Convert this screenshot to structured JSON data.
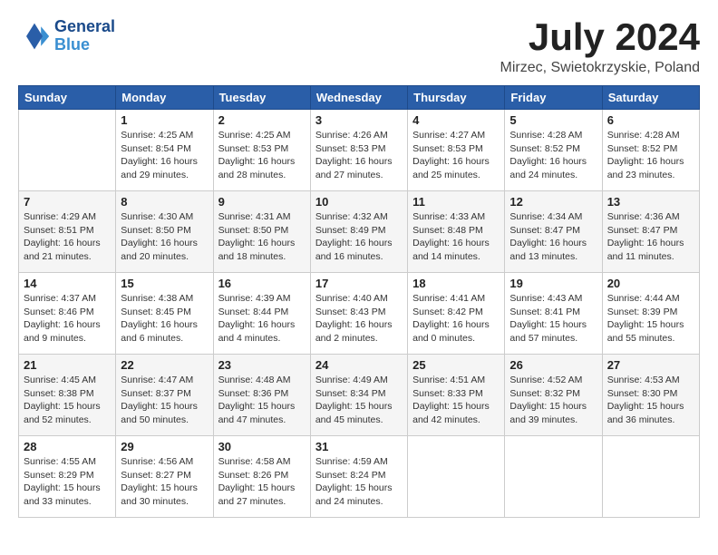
{
  "header": {
    "logo_line1": "General",
    "logo_line2": "Blue",
    "month_title": "July 2024",
    "location": "Mirzec, Swietokrzyskie, Poland"
  },
  "weekdays": [
    "Sunday",
    "Monday",
    "Tuesday",
    "Wednesday",
    "Thursday",
    "Friday",
    "Saturday"
  ],
  "weeks": [
    [
      {
        "day": "",
        "info": ""
      },
      {
        "day": "1",
        "info": "Sunrise: 4:25 AM\nSunset: 8:54 PM\nDaylight: 16 hours\nand 29 minutes."
      },
      {
        "day": "2",
        "info": "Sunrise: 4:25 AM\nSunset: 8:53 PM\nDaylight: 16 hours\nand 28 minutes."
      },
      {
        "day": "3",
        "info": "Sunrise: 4:26 AM\nSunset: 8:53 PM\nDaylight: 16 hours\nand 27 minutes."
      },
      {
        "day": "4",
        "info": "Sunrise: 4:27 AM\nSunset: 8:53 PM\nDaylight: 16 hours\nand 25 minutes."
      },
      {
        "day": "5",
        "info": "Sunrise: 4:28 AM\nSunset: 8:52 PM\nDaylight: 16 hours\nand 24 minutes."
      },
      {
        "day": "6",
        "info": "Sunrise: 4:28 AM\nSunset: 8:52 PM\nDaylight: 16 hours\nand 23 minutes."
      }
    ],
    [
      {
        "day": "7",
        "info": "Sunrise: 4:29 AM\nSunset: 8:51 PM\nDaylight: 16 hours\nand 21 minutes."
      },
      {
        "day": "8",
        "info": "Sunrise: 4:30 AM\nSunset: 8:50 PM\nDaylight: 16 hours\nand 20 minutes."
      },
      {
        "day": "9",
        "info": "Sunrise: 4:31 AM\nSunset: 8:50 PM\nDaylight: 16 hours\nand 18 minutes."
      },
      {
        "day": "10",
        "info": "Sunrise: 4:32 AM\nSunset: 8:49 PM\nDaylight: 16 hours\nand 16 minutes."
      },
      {
        "day": "11",
        "info": "Sunrise: 4:33 AM\nSunset: 8:48 PM\nDaylight: 16 hours\nand 14 minutes."
      },
      {
        "day": "12",
        "info": "Sunrise: 4:34 AM\nSunset: 8:47 PM\nDaylight: 16 hours\nand 13 minutes."
      },
      {
        "day": "13",
        "info": "Sunrise: 4:36 AM\nSunset: 8:47 PM\nDaylight: 16 hours\nand 11 minutes."
      }
    ],
    [
      {
        "day": "14",
        "info": "Sunrise: 4:37 AM\nSunset: 8:46 PM\nDaylight: 16 hours\nand 9 minutes."
      },
      {
        "day": "15",
        "info": "Sunrise: 4:38 AM\nSunset: 8:45 PM\nDaylight: 16 hours\nand 6 minutes."
      },
      {
        "day": "16",
        "info": "Sunrise: 4:39 AM\nSunset: 8:44 PM\nDaylight: 16 hours\nand 4 minutes."
      },
      {
        "day": "17",
        "info": "Sunrise: 4:40 AM\nSunset: 8:43 PM\nDaylight: 16 hours\nand 2 minutes."
      },
      {
        "day": "18",
        "info": "Sunrise: 4:41 AM\nSunset: 8:42 PM\nDaylight: 16 hours\nand 0 minutes."
      },
      {
        "day": "19",
        "info": "Sunrise: 4:43 AM\nSunset: 8:41 PM\nDaylight: 15 hours\nand 57 minutes."
      },
      {
        "day": "20",
        "info": "Sunrise: 4:44 AM\nSunset: 8:39 PM\nDaylight: 15 hours\nand 55 minutes."
      }
    ],
    [
      {
        "day": "21",
        "info": "Sunrise: 4:45 AM\nSunset: 8:38 PM\nDaylight: 15 hours\nand 52 minutes."
      },
      {
        "day": "22",
        "info": "Sunrise: 4:47 AM\nSunset: 8:37 PM\nDaylight: 15 hours\nand 50 minutes."
      },
      {
        "day": "23",
        "info": "Sunrise: 4:48 AM\nSunset: 8:36 PM\nDaylight: 15 hours\nand 47 minutes."
      },
      {
        "day": "24",
        "info": "Sunrise: 4:49 AM\nSunset: 8:34 PM\nDaylight: 15 hours\nand 45 minutes."
      },
      {
        "day": "25",
        "info": "Sunrise: 4:51 AM\nSunset: 8:33 PM\nDaylight: 15 hours\nand 42 minutes."
      },
      {
        "day": "26",
        "info": "Sunrise: 4:52 AM\nSunset: 8:32 PM\nDaylight: 15 hours\nand 39 minutes."
      },
      {
        "day": "27",
        "info": "Sunrise: 4:53 AM\nSunset: 8:30 PM\nDaylight: 15 hours\nand 36 minutes."
      }
    ],
    [
      {
        "day": "28",
        "info": "Sunrise: 4:55 AM\nSunset: 8:29 PM\nDaylight: 15 hours\nand 33 minutes."
      },
      {
        "day": "29",
        "info": "Sunrise: 4:56 AM\nSunset: 8:27 PM\nDaylight: 15 hours\nand 30 minutes."
      },
      {
        "day": "30",
        "info": "Sunrise: 4:58 AM\nSunset: 8:26 PM\nDaylight: 15 hours\nand 27 minutes."
      },
      {
        "day": "31",
        "info": "Sunrise: 4:59 AM\nSunset: 8:24 PM\nDaylight: 15 hours\nand 24 minutes."
      },
      {
        "day": "",
        "info": ""
      },
      {
        "day": "",
        "info": ""
      },
      {
        "day": "",
        "info": ""
      }
    ]
  ]
}
